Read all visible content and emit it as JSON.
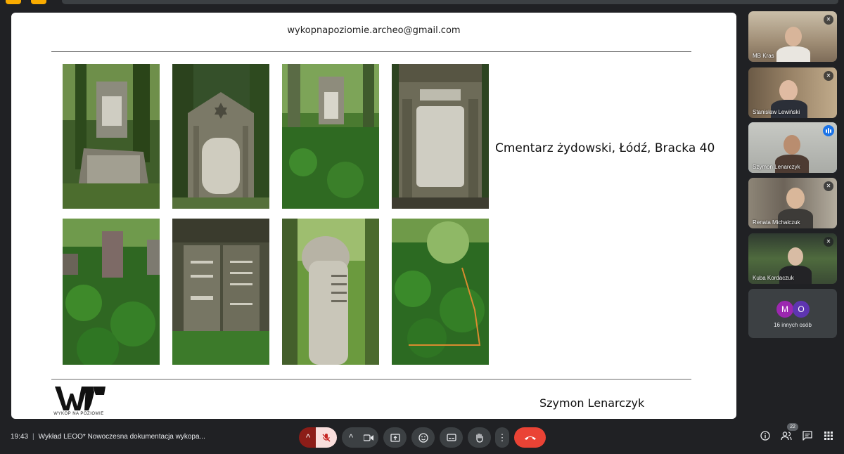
{
  "slide": {
    "email": "wykopnapoziomie.archeo@gmail.com",
    "caption": "Cmentarz żydowski, Łódź, Bracka 40",
    "speaker": "Szymon Lenarczyk",
    "logo_text": "WYKOP NA POZIOMIE",
    "photos": [
      {
        "name": "photo-grave-ivy-slab",
        "kind": "overgrown tombstone"
      },
      {
        "name": "photo-grave-star-of-david",
        "kind": "tombstone with star"
      },
      {
        "name": "photo-grave-small-distant",
        "kind": "tombstone in ivy"
      },
      {
        "name": "photo-grave-pillared-facade",
        "kind": "pillared tombstone"
      },
      {
        "name": "photo-grave-ivy-field",
        "kind": "tombstone in ivy field"
      },
      {
        "name": "photo-grave-tablets-inscription",
        "kind": "twin tablets"
      },
      {
        "name": "photo-grave-carved-tree",
        "kind": "carved tree trunk"
      },
      {
        "name": "photo-grave-survey-plot",
        "kind": "ivy plot"
      }
    ]
  },
  "participants": [
    {
      "name": "MB Kras",
      "muted": true,
      "active": false
    },
    {
      "name": "Stanisław Lewiński",
      "muted": true,
      "active": false
    },
    {
      "name": "Szymon Lenarczyk",
      "muted": false,
      "active": true
    },
    {
      "name": "Renata Michalczuk",
      "muted": true,
      "active": false
    },
    {
      "name": "Kuba Kordaczuk",
      "muted": true,
      "active": false
    }
  ],
  "others": {
    "label": "16 innych osób",
    "avatars": [
      {
        "letter": "M",
        "color": "#9c27b0"
      },
      {
        "letter": "O",
        "color": "#5e35b1"
      }
    ]
  },
  "bottom_bar": {
    "time": "19:43",
    "meeting_title": "Wykład LEOO* Nowoczesna dokumentacja wykopa...",
    "participant_count": "22",
    "controls": [
      "chevron-up-icon",
      "mic-off-icon",
      "chevron-up-icon",
      "camera-icon",
      "present-icon",
      "emoji-icon",
      "captions-icon",
      "raise-hand-icon",
      "more-icon",
      "end-call-icon"
    ],
    "right_icons": [
      "info-icon",
      "people-icon",
      "chat-icon",
      "activities-icon"
    ]
  }
}
